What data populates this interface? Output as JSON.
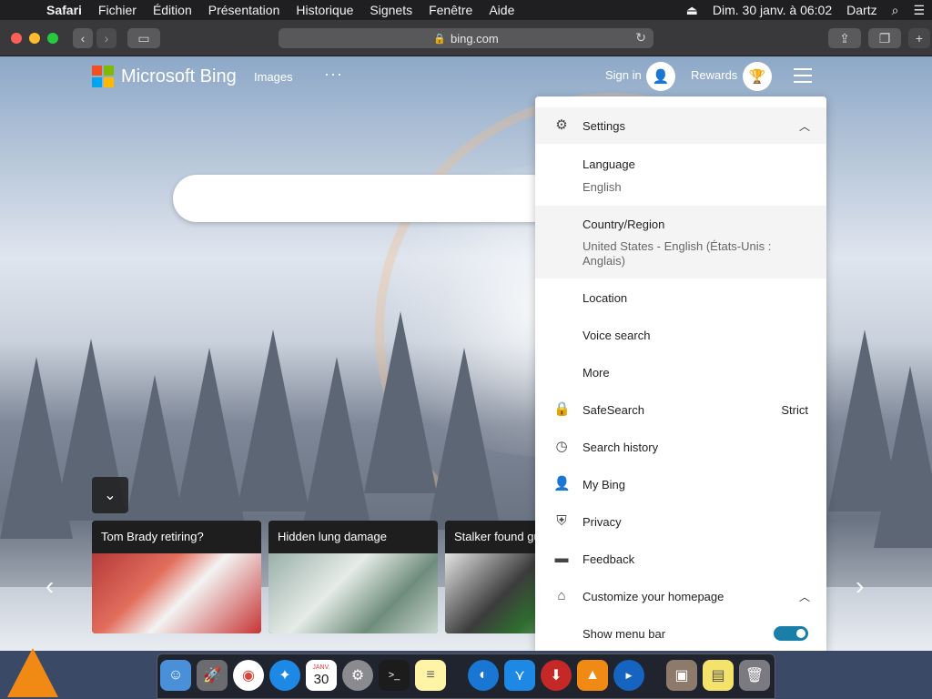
{
  "menubar": {
    "app": "Safari",
    "items": [
      "Fichier",
      "Édition",
      "Présentation",
      "Historique",
      "Signets",
      "Fenêtre",
      "Aide"
    ],
    "clock": "Dim. 30 janv. à  06:02",
    "user": "Dartz",
    "icons": [
      "apple-icon",
      "eject-icon",
      "spotlight-search-icon",
      "control-center-icon"
    ]
  },
  "browser": {
    "url": "bing.com",
    "icons": [
      "back-icon",
      "forward-icon",
      "sidebar-icon",
      "lock-icon",
      "reload-icon",
      "share-icon",
      "tabs-icon",
      "new-tab-icon"
    ]
  },
  "bing": {
    "logo_text": "Microsoft Bing",
    "nav_images": "Images",
    "nav_more": "···",
    "sign_in": "Sign in",
    "rewards": "Rewards"
  },
  "news": [
    {
      "title": "Tom Brady retiring?"
    },
    {
      "title": "Hidden lung damage"
    },
    {
      "title": "Stalker found gu"
    }
  ],
  "settings_panel": {
    "header": "Settings",
    "language_label": "Language",
    "language_value": "English",
    "country_label": "Country/Region",
    "country_value_line1": "United States - English (États-Unis :",
    "country_value_line2": "Anglais)",
    "location": "Location",
    "voice_search": "Voice search",
    "more": "More",
    "safesearch": "SafeSearch",
    "safesearch_value": "Strict",
    "search_history": "Search history",
    "my_bing": "My Bing",
    "privacy": "Privacy",
    "feedback": "Feedback",
    "customize": "Customize your homepage",
    "show_menu_bar": "Show menu bar",
    "show_menu_bar_on": true
  },
  "dock": {
    "calendar_month": "JANV.",
    "calendar_day": "30",
    "apps": [
      "vlc-icon",
      "finder-icon",
      "launchpad-icon",
      "chrome-icon",
      "safari-icon",
      "calendar-icon",
      "system-preferences-icon",
      "terminal-icon",
      "notes-icon",
      "edge-icon",
      "vscode-icon",
      "downloader-icon",
      "vlc-icon",
      "youtube-icon",
      "photo-icon",
      "stickies-icon",
      "trash-icon"
    ]
  },
  "colors": {
    "ms_red": "#f25022",
    "ms_green": "#7fba00",
    "ms_blue": "#00a4ef",
    "ms_yellow": "#ffb900",
    "toggle_on": "#1a7fa8"
  }
}
